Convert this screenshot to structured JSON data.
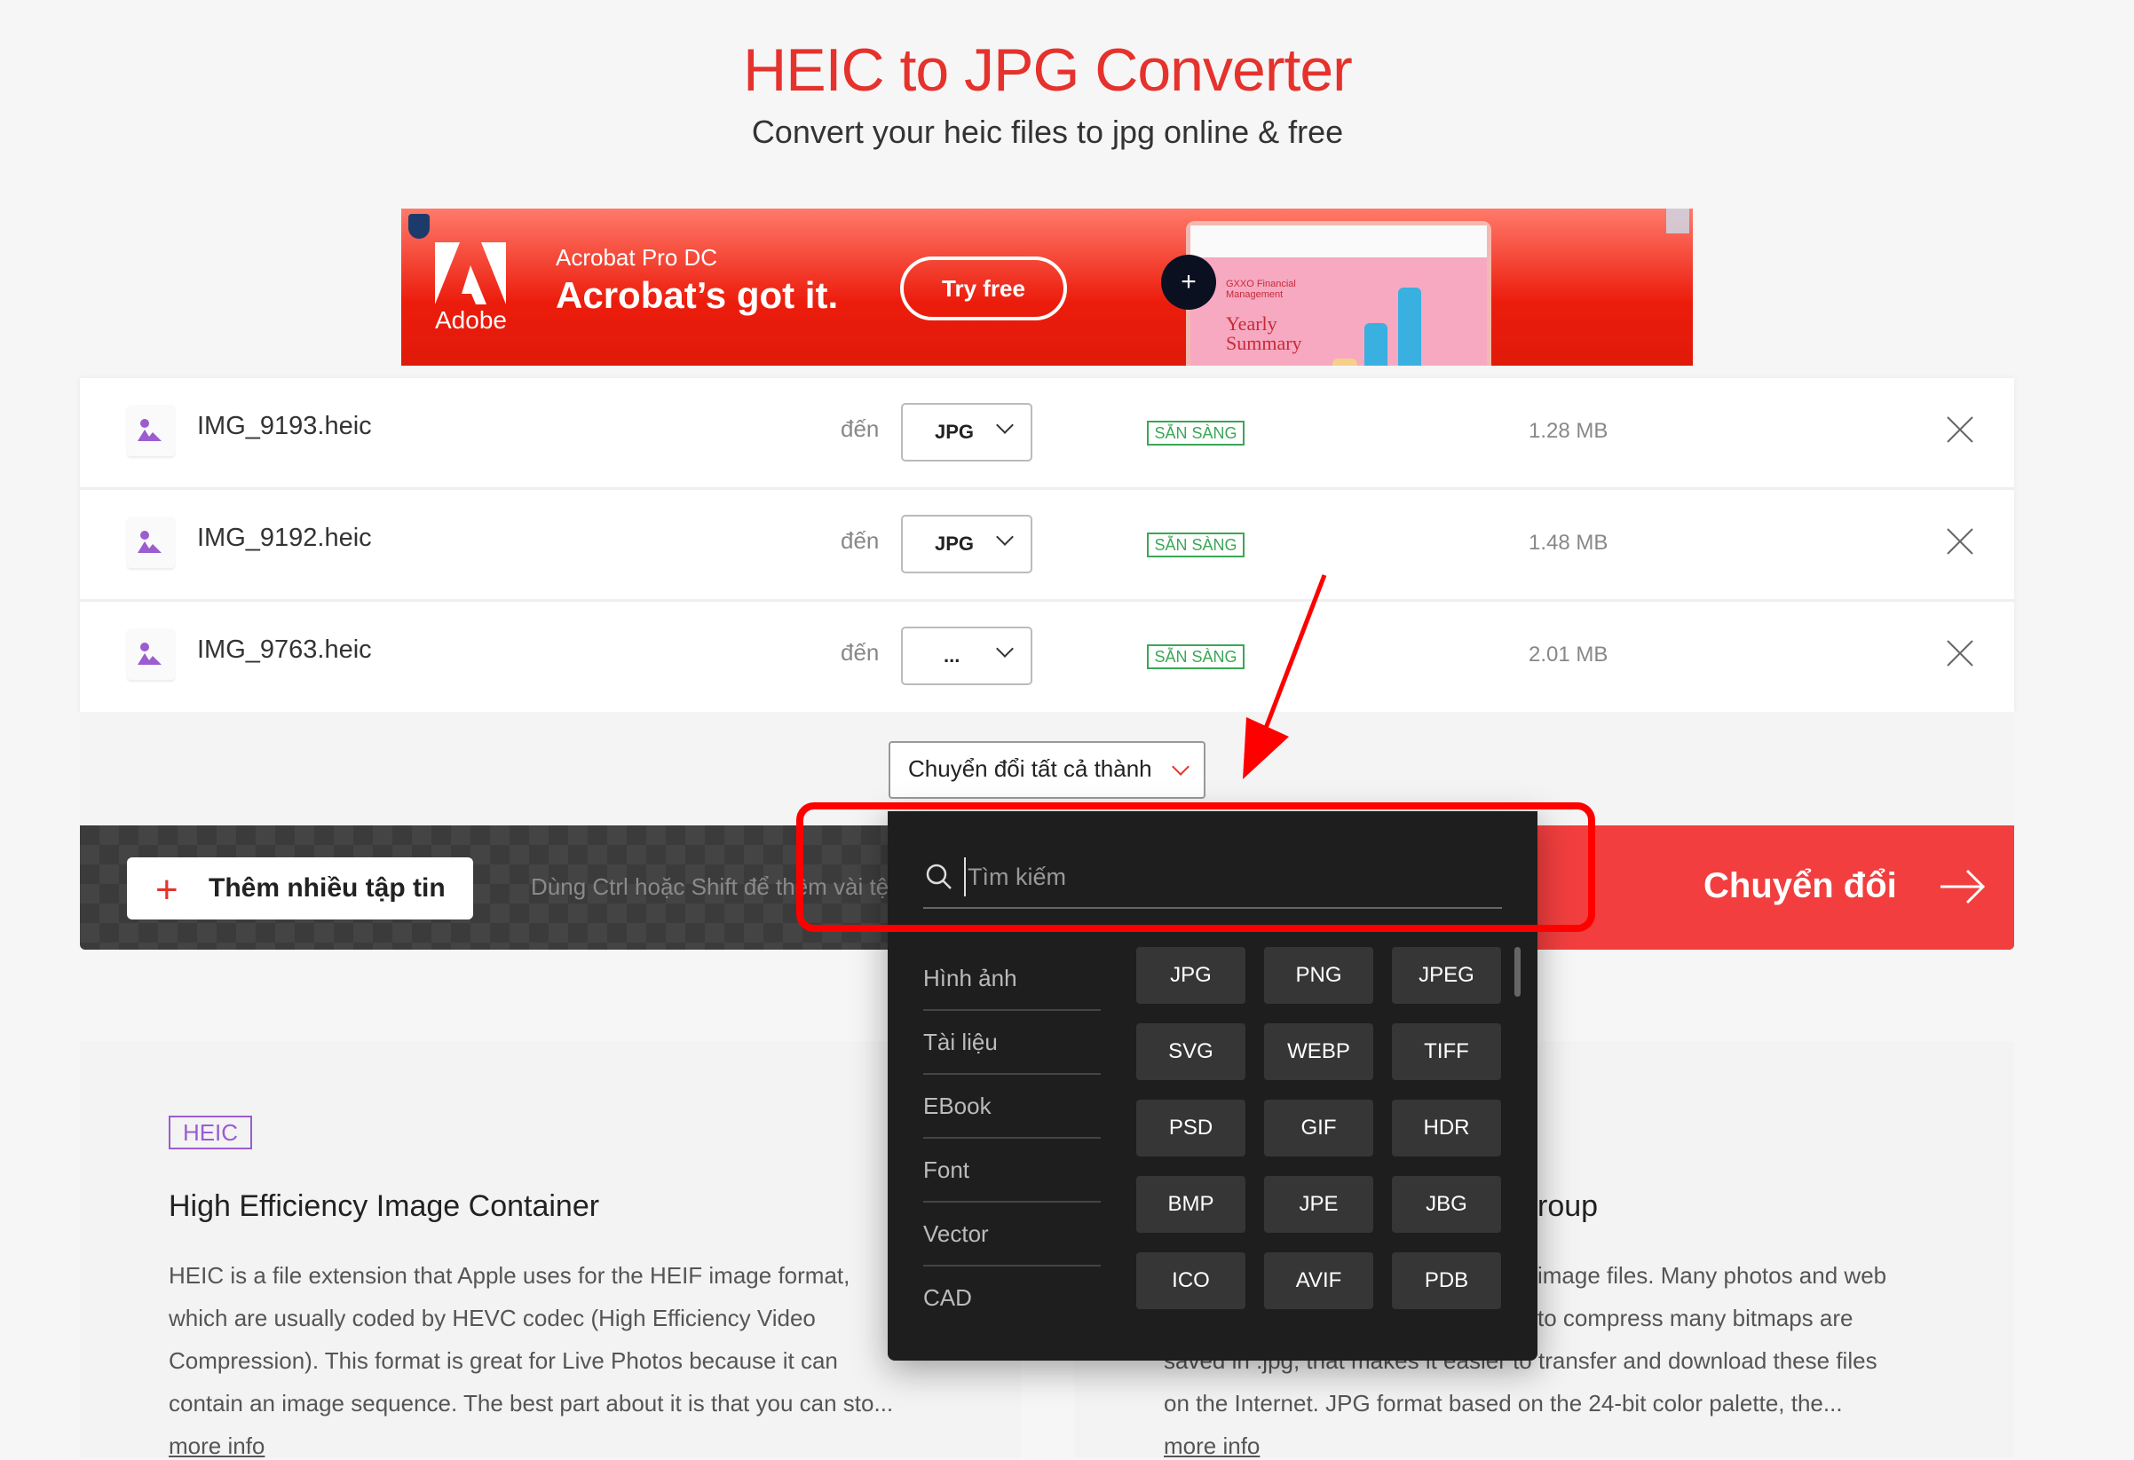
{
  "header": {
    "title": "HEIC to JPG Converter",
    "subtitle": "Convert your heic files to jpg online & free"
  },
  "ad": {
    "brand": "Adobe",
    "product": "Acrobat Pro DC",
    "headline": "Acrobat’s got it.",
    "cta": "Try free",
    "mock_title": "Yearly Summary",
    "mock_company": "GXXO Financial Management"
  },
  "files": [
    {
      "name": "IMG_9193.heic",
      "to_label": "đến",
      "format": "JPG",
      "status": "SẴN SÀNG",
      "size": "1.28 MB"
    },
    {
      "name": "IMG_9192.heic",
      "to_label": "đến",
      "format": "JPG",
      "status": "SẴN SÀNG",
      "size": "1.48 MB"
    },
    {
      "name": "IMG_9763.heic",
      "to_label": "đến",
      "format": "...",
      "status": "SẴN SÀNG",
      "size": "2.01 MB"
    }
  ],
  "convert_all": {
    "label": "Chuyển đổi tất cả thành"
  },
  "toolbar": {
    "add_files": "Thêm nhiều tập tin",
    "hint": "Dùng Ctrl hoặc Shift để thêm vài tệ",
    "convert": "Chuyển đổi"
  },
  "dropdown": {
    "search_placeholder": "Tìm kiếm",
    "categories": [
      "Hình ảnh",
      "Tài liệu",
      "EBook",
      "Font",
      "Vector",
      "CAD"
    ],
    "formats": [
      "JPG",
      "PNG",
      "JPEG",
      "SVG",
      "WEBP",
      "TIFF",
      "PSD",
      "GIF",
      "HDR",
      "BMP",
      "JPE",
      "JBG",
      "ICO",
      "AVIF",
      "PDB"
    ]
  },
  "info": {
    "left": {
      "badge": "HEIC",
      "heading": "High Efficiency Image Container",
      "lines": [
        "HEIC is a file extension that Apple uses for the HEIF image format,",
        "which are usually coded by HEVC codec (High Efficiency Video",
        "Compression). This format is great for Live Photos because it can",
        "contain an image sequence. The best part about it is that you can sto..."
      ],
      "more": "more info"
    },
    "right": {
      "heading_fragment": "roup",
      "lines": [
        "image files. Many photos and web",
        "to compress many bitmaps are",
        "saved in .jpg, that makes it easier to transfer and download these files",
        "on the Internet. JPG format based on the 24-bit color palette, the..."
      ],
      "more": "more info"
    }
  },
  "colors": {
    "brand_red": "#e5322d",
    "convert_red": "#f23e3e",
    "ready_green": "#3aa757",
    "heic_purple": "#9b5dcf",
    "annotation_red": "#ff0000"
  }
}
